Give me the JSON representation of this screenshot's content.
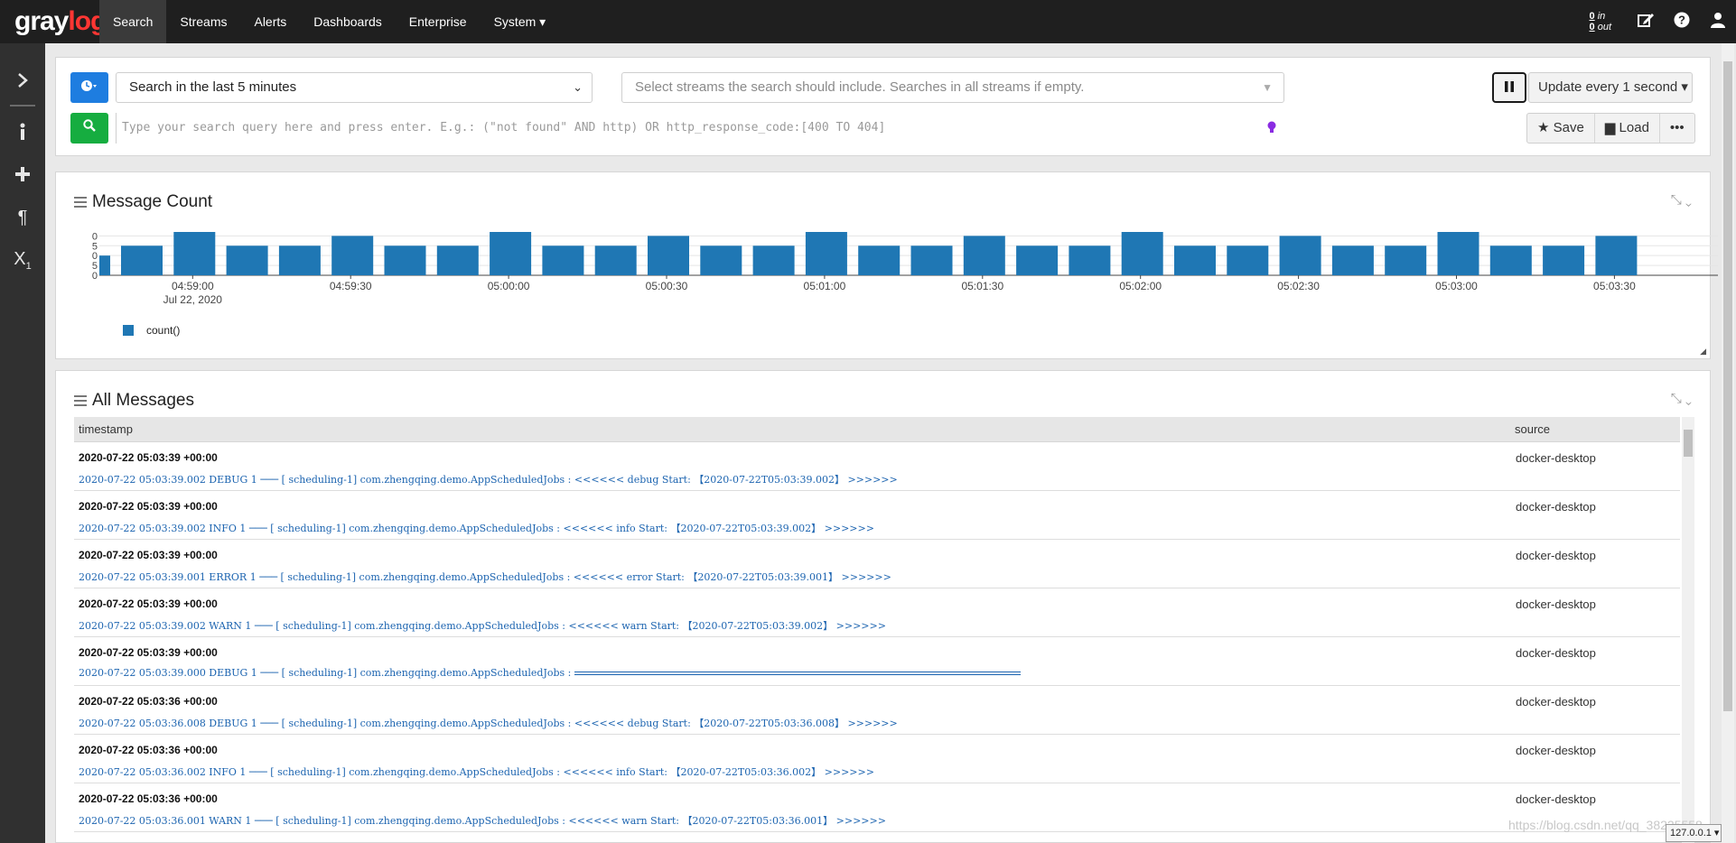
{
  "navbar": {
    "brand_a": "gray",
    "brand_b": "log",
    "items": [
      {
        "label": "Search",
        "active": true
      },
      {
        "label": "Streams"
      },
      {
        "label": "Alerts"
      },
      {
        "label": "Dashboards"
      },
      {
        "label": "Enterprise"
      },
      {
        "label": "System ▾"
      }
    ],
    "throughput_in": "0",
    "throughput_in_label": "in",
    "throughput_out": "0",
    "throughput_out_label": "out",
    "icons": [
      "edit-icon",
      "help-icon",
      "user-icon"
    ]
  },
  "sidebar": {
    "icons": [
      "chevron-right-icon",
      "info-icon",
      "plus-icon",
      "paragraph-icon",
      "subscript-icon"
    ]
  },
  "search": {
    "time_range": "Search in the last 5 minutes",
    "streams_placeholder": "Select streams the search should include. Searches in all streams if empty.",
    "refresh_label": "Update every 1 second ▾",
    "query_placeholder": "Type your search query here and press enter. E.g.: (\"not found\" AND http) OR http_response_code:[400 TO 404]",
    "save_label": "Save",
    "load_label": "Load",
    "more_label": "•••"
  },
  "message_count": {
    "title": "Message Count",
    "legend": "count()"
  },
  "chart_data": {
    "type": "bar",
    "title": "Message Count",
    "x_ticks": [
      "04:59:00",
      "04:59:30",
      "05:00:00",
      "05:00:30",
      "05:01:00",
      "05:01:30",
      "05:02:00",
      "05:02:30",
      "05:03:00",
      "05:03:30"
    ],
    "x_tick_subtitle": "Jul 22, 2020",
    "y_ticks": [
      0,
      5,
      10,
      15,
      20
    ],
    "ylim": [
      0,
      22
    ],
    "series": [
      {
        "name": "count()",
        "color": "#1f77b4",
        "values": [
          10,
          15,
          22,
          15,
          15,
          20,
          15,
          15,
          22,
          15,
          15,
          20,
          15,
          15,
          22,
          15,
          15,
          20,
          15,
          15,
          22,
          15,
          15,
          20,
          15,
          15,
          22,
          15,
          15,
          20
        ]
      }
    ]
  },
  "messages": {
    "title": "All Messages",
    "col_timestamp": "timestamp",
    "col_source": "source",
    "rows": [
      {
        "ts": "2020-07-22 05:03:39 +00:00",
        "src": "docker-desktop",
        "msg": "2020-07-22 05:03:39.002 DEBUG 1 ─── [ scheduling-1] com.zhengqing.demo.AppScheduledJobs : <<<<<< debug Start: 【2020-07-22T05:03:39.002】 >>>>>>"
      },
      {
        "ts": "2020-07-22 05:03:39 +00:00",
        "src": "docker-desktop",
        "msg": "2020-07-22 05:03:39.002 INFO 1 ─── [ scheduling-1] com.zhengqing.demo.AppScheduledJobs : <<<<<< info Start: 【2020-07-22T05:03:39.002】 >>>>>>"
      },
      {
        "ts": "2020-07-22 05:03:39 +00:00",
        "src": "docker-desktop",
        "msg": "2020-07-22 05:03:39.001 ERROR 1 ─── [ scheduling-1] com.zhengqing.demo.AppScheduledJobs : <<<<<< error Start: 【2020-07-22T05:03:39.001】 >>>>>>"
      },
      {
        "ts": "2020-07-22 05:03:39 +00:00",
        "src": "docker-desktop",
        "msg": "2020-07-22 05:03:39.002 WARN 1 ─── [ scheduling-1] com.zhengqing.demo.AppScheduledJobs : <<<<<< warn Start: 【2020-07-22T05:03:39.002】 >>>>>>"
      },
      {
        "ts": "2020-07-22 05:03:39 +00:00",
        "src": "docker-desktop",
        "msg": "2020-07-22 05:03:39.000 DEBUG 1 ─── [ scheduling-1] com.zhengqing.demo.AppScheduledJobs : ",
        "bar": true
      },
      {
        "ts": "2020-07-22 05:03:36 +00:00",
        "src": "docker-desktop",
        "msg": "2020-07-22 05:03:36.008 DEBUG 1 ─── [ scheduling-1] com.zhengqing.demo.AppScheduledJobs : <<<<<< debug Start: 【2020-07-22T05:03:36.008】 >>>>>>"
      },
      {
        "ts": "2020-07-22 05:03:36 +00:00",
        "src": "docker-desktop",
        "msg": "2020-07-22 05:03:36.002 INFO 1 ─── [ scheduling-1] com.zhengqing.demo.AppScheduledJobs : <<<<<< info Start: 【2020-07-22T05:03:36.002】 >>>>>>"
      },
      {
        "ts": "2020-07-22 05:03:36 +00:00",
        "src": "docker-desktop",
        "msg": "2020-07-22 05:03:36.001 WARN 1 ─── [ scheduling-1] com.zhengqing.demo.AppScheduledJobs : <<<<<< warn Start: 【2020-07-22T05:03:36.001】 >>>>>>"
      }
    ]
  },
  "footer": {
    "watermark": "https://blog.csdn.net/qq_38225558",
    "host": "127.0.0.1 ▾"
  }
}
